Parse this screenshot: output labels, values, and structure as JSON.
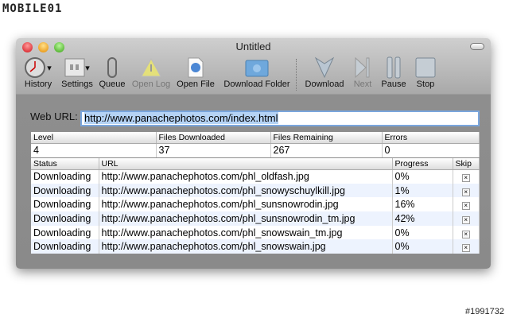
{
  "watermark_logo": "MOBILE01",
  "watermark_id": "#1991732",
  "window": {
    "title": "Untitled"
  },
  "toolbar": [
    {
      "label": "History",
      "icon": "clock-icon",
      "enabled": true
    },
    {
      "label": "Settings",
      "icon": "switches-icon",
      "enabled": true
    },
    {
      "label": "Queue",
      "icon": "paperclip-icon",
      "enabled": true
    },
    {
      "label": "Open Log",
      "icon": "warning-icon",
      "enabled": false
    },
    {
      "label": "Open File",
      "icon": "file-icon",
      "enabled": true
    },
    {
      "label": "Download Folder",
      "icon": "folder-icon",
      "enabled": true
    },
    {
      "label": "Download",
      "icon": "download-arrow-icon",
      "enabled": true
    },
    {
      "label": "Next",
      "icon": "next-icon",
      "enabled": false
    },
    {
      "label": "Pause",
      "icon": "pause-icon",
      "enabled": true
    },
    {
      "label": "Stop",
      "icon": "stop-icon",
      "enabled": true
    }
  ],
  "url": {
    "label": "Web URL:",
    "value": "http://www.panachephotos.com/index.html"
  },
  "stats": {
    "headers": [
      "Level",
      "Files Downloaded",
      "Files Remaining",
      "Errors"
    ],
    "values": [
      "4",
      "37",
      "267",
      "0"
    ]
  },
  "downloads": {
    "headers": [
      "Status",
      "URL",
      "Progress",
      "Skip"
    ],
    "skip_glyph": "×",
    "rows": [
      {
        "status": "Downloading",
        "url": "http://www.panachephotos.com/phl_oldfash.jpg",
        "progress": "0%"
      },
      {
        "status": "Downloading",
        "url": "http://www.panachephotos.com/phl_snowyschuylkill.jpg",
        "progress": "1%"
      },
      {
        "status": "Downloading",
        "url": "http://www.panachephotos.com/phl_sunsnowrodin.jpg",
        "progress": "16%"
      },
      {
        "status": "Downloading",
        "url": "http://www.panachephotos.com/phl_sunsnowrodin_tm.jpg",
        "progress": "42%"
      },
      {
        "status": "Downloading",
        "url": "http://www.panachephotos.com/phl_snowswain_tm.jpg",
        "progress": "0%"
      },
      {
        "status": "Downloading",
        "url": "http://www.panachephotos.com/phl_snowswain.jpg",
        "progress": "0%"
      }
    ]
  }
}
